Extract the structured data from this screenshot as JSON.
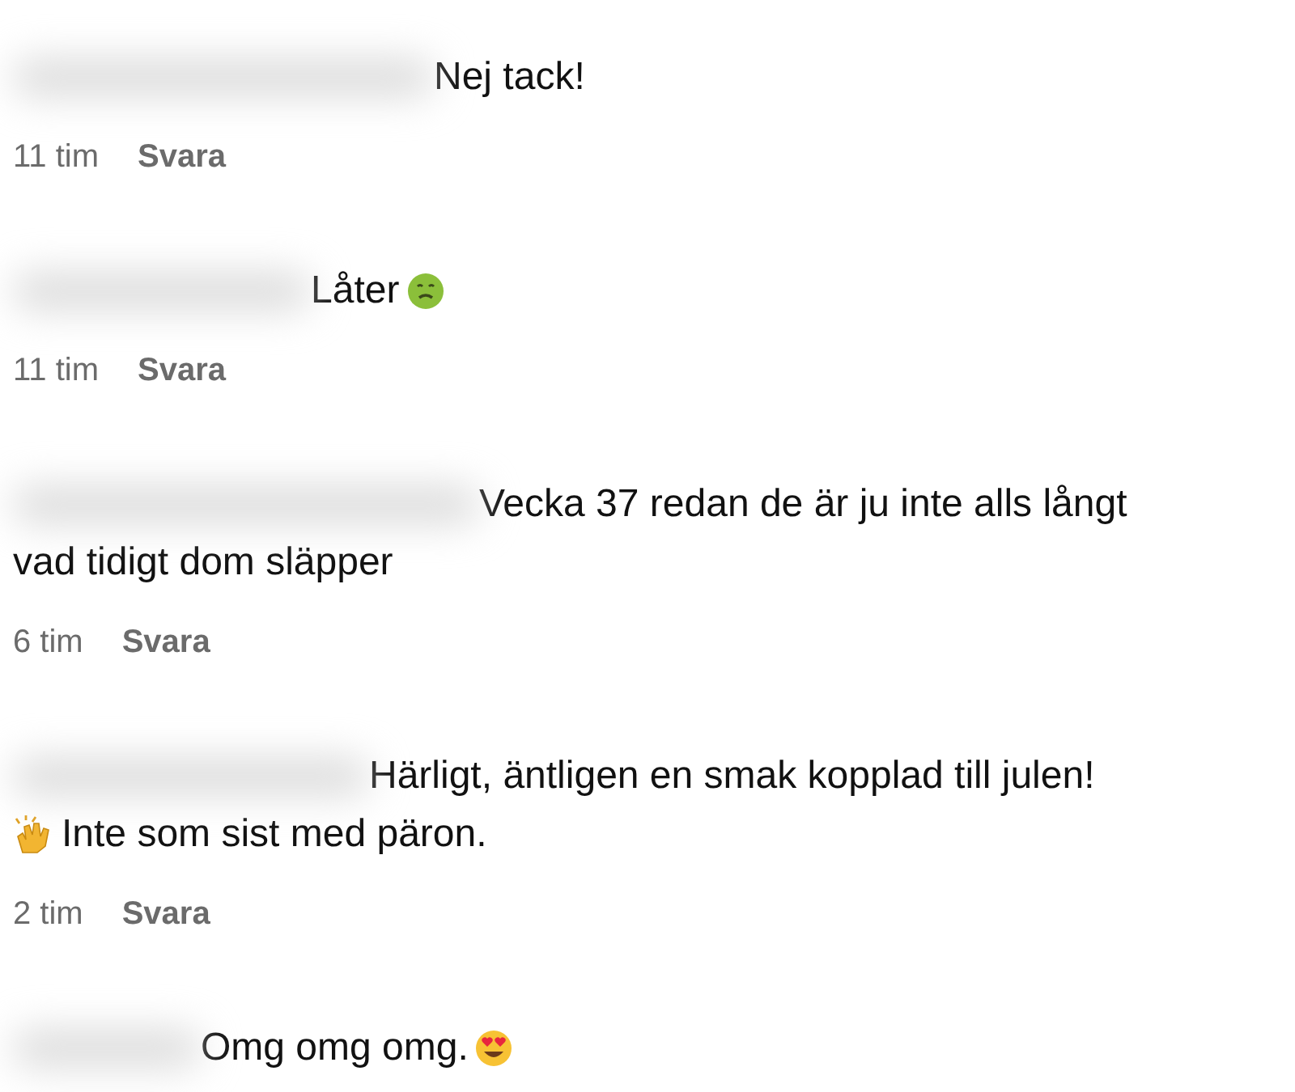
{
  "comments": [
    {
      "lines": [
        [
          {
            "kind": "text",
            "text": "Nej tack!"
          }
        ]
      ],
      "time": "11 tim",
      "reply": "Svara"
    },
    {
      "lines": [
        [
          {
            "kind": "text",
            "text": "Låter"
          },
          {
            "kind": "emoji"
          }
        ]
      ],
      "time": "11 tim",
      "reply": "Svara"
    },
    {
      "lines": [
        [
          {
            "kind": "text",
            "text": "Vecka 37 redan de är ju inte alls långt"
          }
        ],
        [
          {
            "kind": "text",
            "text": "vad tidigt dom släpper"
          }
        ]
      ],
      "time": "6 tim",
      "reply": "Svara"
    },
    {
      "lines": [
        [
          {
            "kind": "text",
            "text": "Härligt, äntligen en smak kopplad till julen!"
          }
        ],
        [
          {
            "kind": "emoji"
          },
          {
            "kind": "text",
            "text": "Inte som sist med päron."
          }
        ]
      ],
      "time": "2 tim",
      "reply": "Svara"
    },
    {
      "lines": [
        [
          {
            "kind": "text",
            "text": "Omg omg omg."
          },
          {
            "kind": "emoji"
          }
        ]
      ]
    }
  ]
}
